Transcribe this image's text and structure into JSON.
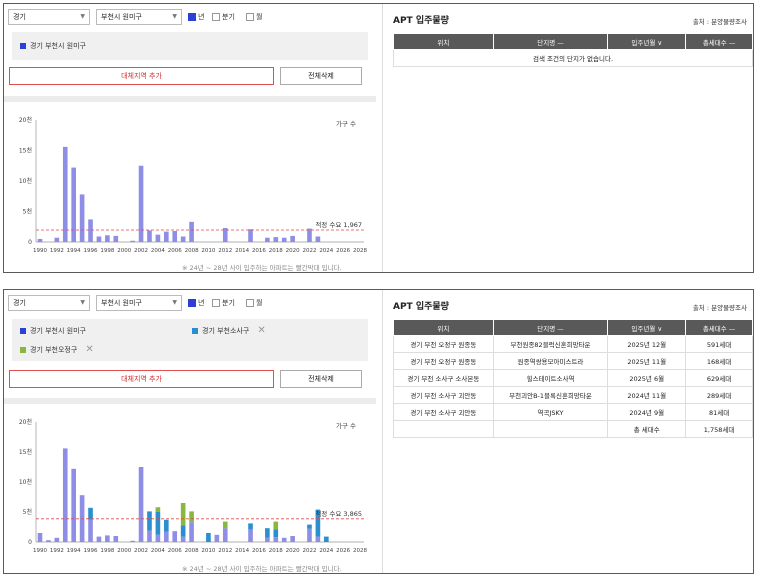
{
  "panels": [
    {
      "filters": {
        "province": "경기",
        "district": "부천시 원미구"
      },
      "period": [
        {
          "label": "년",
          "checked": true
        },
        {
          "label": "분기",
          "checked": false
        },
        {
          "label": "월",
          "checked": false
        }
      ],
      "tags": [
        {
          "label": "경기 부천시 원미구",
          "color": "#2d3fd6",
          "removable": false
        }
      ],
      "buttons": {
        "add": "대체지역 추가",
        "clear": "전체삭제"
      },
      "chart_data": {
        "type": "bar",
        "legend": "가구 수",
        "yticks": [
          "20천",
          "15천",
          "10천",
          "5천",
          "0"
        ],
        "ylim": [
          0,
          20000
        ],
        "xticks": [
          "1990",
          "1992",
          "1994",
          "1996",
          "1998",
          "2000",
          "2002",
          "2004",
          "2006",
          "2008",
          "2010",
          "2012",
          "2014",
          "2016",
          "2018",
          "2020",
          "2022",
          "2024",
          "2026",
          "2028"
        ],
        "x": [
          1990,
          1991,
          1992,
          1993,
          1994,
          1995,
          1996,
          1997,
          1998,
          1999,
          2000,
          2001,
          2002,
          2003,
          2004,
          2005,
          2006,
          2007,
          2008,
          2009,
          2010,
          2011,
          2012,
          2013,
          2014,
          2015,
          2016,
          2017,
          2018,
          2019,
          2020,
          2021,
          2022,
          2023,
          2024,
          2025,
          2026,
          2027,
          2028
        ],
        "series": [
          {
            "color": "#8e8ee6",
            "values": [
              500,
              0,
              700,
              15600,
              12200,
              7800,
              3700,
              900,
              1100,
              1000,
              0,
              200,
              12500,
              1900,
              1200,
              1700,
              1800,
              900,
              3300,
              0,
              0,
              0,
              2300,
              0,
              0,
              2100,
              0,
              700,
              800,
              700,
              1000,
              0,
              2200,
              900,
              0,
              0,
              0,
              0,
              0
            ]
          }
        ],
        "reference": {
          "label": "적정 수요 1,967",
          "value": 1967
        }
      },
      "note": "※ 24년 ~ 28년 사이 입주하는 아파트는 빨간막대 입니다."
    },
    {
      "filters": {
        "province": "경기",
        "district": "부천시 원미구"
      },
      "period": [
        {
          "label": "년",
          "checked": true
        },
        {
          "label": "분기",
          "checked": false
        },
        {
          "label": "월",
          "checked": false
        }
      ],
      "tags": [
        {
          "label": "경기 부천시 원미구",
          "color": "#2d3fd6",
          "removable": false
        },
        {
          "label": "경기 부천소사구",
          "color": "#2b8fcf",
          "removable": true
        },
        {
          "label": "경기 부천오정구",
          "color": "#8ab83e",
          "removable": true
        }
      ],
      "buttons": {
        "add": "대체지역 추가",
        "clear": "전체삭제"
      },
      "chart_data": {
        "type": "bar",
        "legend": "가구 수",
        "yticks": [
          "20천",
          "15천",
          "10천",
          "5천",
          "0"
        ],
        "ylim": [
          0,
          20000
        ],
        "xticks": [
          "1990",
          "1992",
          "1994",
          "1996",
          "1998",
          "2000",
          "2002",
          "2004",
          "2006",
          "2008",
          "2010",
          "2012",
          "2014",
          "2016",
          "2018",
          "2020",
          "2022",
          "2024",
          "2026",
          "2028"
        ],
        "x": [
          1990,
          1991,
          1992,
          1993,
          1994,
          1995,
          1996,
          1997,
          1998,
          1999,
          2000,
          2001,
          2002,
          2003,
          2004,
          2005,
          2006,
          2007,
          2008,
          2009,
          2010,
          2011,
          2012,
          2013,
          2014,
          2015,
          2016,
          2017,
          2018,
          2019,
          2020,
          2021,
          2022,
          2023,
          2024,
          2025,
          2026,
          2027,
          2028
        ],
        "series": [
          {
            "name": "경기 부천시 원미구",
            "color": "#8e8ee6",
            "values": [
              1500,
              300,
              700,
              15600,
              12200,
              7800,
              3700,
              900,
              1100,
              1000,
              0,
              200,
              12500,
              1900,
              1200,
              1700,
              1800,
              900,
              3300,
              0,
              0,
              1200,
              2300,
              0,
              0,
              2100,
              0,
              700,
              800,
              700,
              1000,
              0,
              2200,
              900,
              0,
              0,
              0,
              0,
              0
            ]
          },
          {
            "name": "경기 부천소사구",
            "color": "#2b8fcf",
            "values": [
              0,
              0,
              0,
              0,
              0,
              0,
              2000,
              0,
              0,
              0,
              0,
              0,
              0,
              3200,
              3800,
              2000,
              0,
              1900,
              0,
              0,
              1500,
              0,
              0,
              0,
              0,
              1000,
              0,
              1600,
              1300,
              0,
              0,
              0,
              700,
              4500,
              900,
              0,
              0,
              0,
              0
            ]
          },
          {
            "name": "경기 부천오정구",
            "color": "#8ab83e",
            "values": [
              0,
              0,
              0,
              0,
              0,
              0,
              0,
              0,
              0,
              0,
              0,
              0,
              0,
              0,
              800,
              0,
              0,
              3700,
              1800,
              0,
              0,
              0,
              1100,
              0,
              0,
              0,
              0,
              0,
              1300,
              0,
              0,
              0,
              0,
              0,
              0,
              0,
              0,
              0,
              0
            ]
          }
        ],
        "reference": {
          "label": "적정 수요 3,865",
          "value": 3865
        }
      },
      "note": "※ 24년 ~ 28년 사이 입주하는 아파트는 빨간막대 입니다."
    }
  ],
  "right": [
    {
      "title": "APT 입주물량",
      "source": "출처 : 분양물량조사",
      "headers": [
        "위치",
        "단지명 —",
        "입주년월 ∨",
        "총세대수 —"
      ],
      "empty": "검색 조건의 단지가 없습니다.",
      "rows": []
    },
    {
      "title": "APT 입주물량",
      "source": "출처 : 분양물량조사",
      "headers": [
        "위치",
        "단지명 —",
        "입주년월 ∨",
        "총세대수 —"
      ],
      "rows": [
        [
          "경기 부천 오정구 원종동",
          "부천원종82블럭신혼희망타운",
          "2025년 12월",
          "591세대"
        ],
        [
          "경기 부천 오정구 원종동",
          "원종역쌍용모아미스트라",
          "2025년 11월",
          "168세대"
        ],
        [
          "경기 부천 소사구 소사본동",
          "힐스테이트소사역",
          "2025년 6월",
          "629세대"
        ],
        [
          "경기 부천 소사구 괴안동",
          "부천괴안B-1블록신혼희망타운",
          "2024년 11월",
          "289세대"
        ],
        [
          "경기 부천 소사구 괴안동",
          "역곡JSKY",
          "2024년 9월",
          "81세대"
        ],
        [
          "",
          "",
          "총 세대수",
          "1,758세대"
        ]
      ]
    }
  ]
}
